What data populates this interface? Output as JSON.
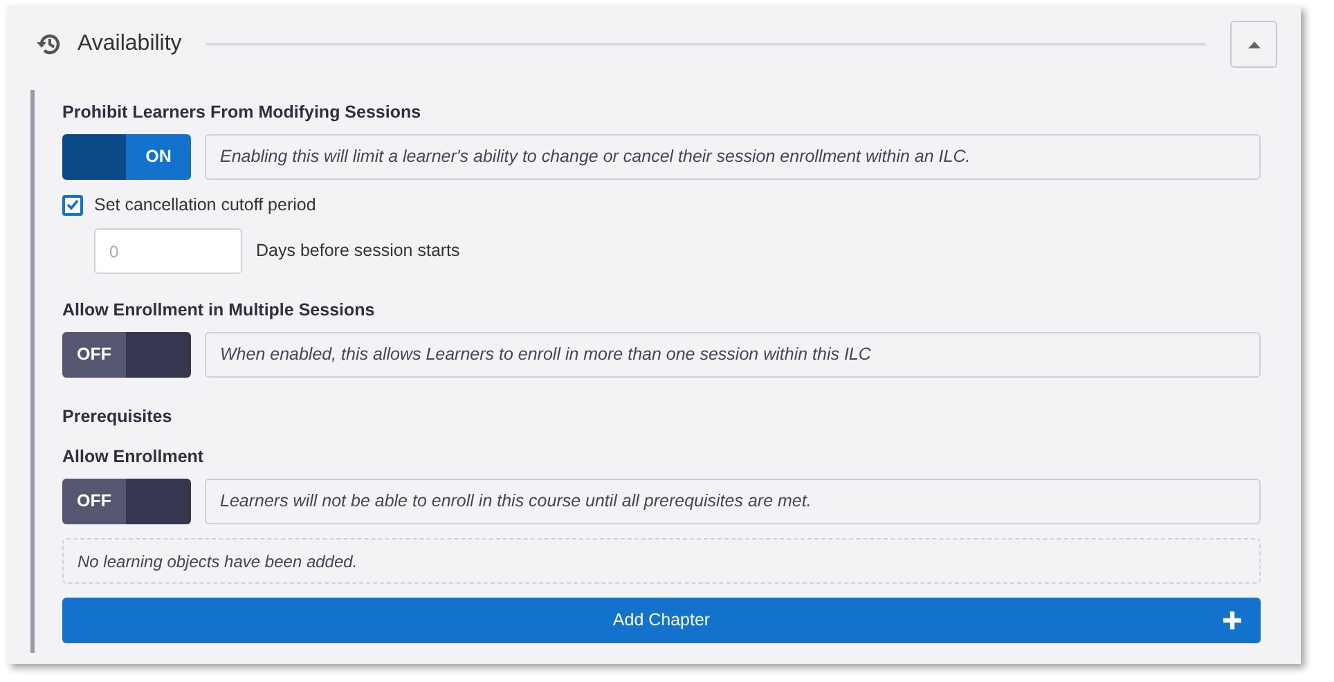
{
  "section": {
    "title": "Availability",
    "expanded": true
  },
  "settings": [
    {
      "kind": "toggle",
      "heading": "Prohibit Learners From Modifying Sessions",
      "on": true,
      "toggle_label": "ON",
      "description": "Enabling this will limit a learner's ability to change or cancel their session enrollment within an ILC."
    },
    {
      "kind": "checkbox",
      "label": "Set cancellation cutoff period",
      "checked": true,
      "field": {
        "placeholder": "0",
        "suffix": "Days before session starts"
      }
    },
    {
      "kind": "toggle",
      "heading": "Allow Enrollment in Multiple Sessions",
      "on": false,
      "toggle_label": "OFF",
      "description": "When enabled, this allows Learners to enroll in more than one session within this ILC"
    },
    {
      "kind": "subheading",
      "text": "Prerequisites"
    },
    {
      "kind": "toggle",
      "heading": "Allow Enrollment",
      "on": false,
      "toggle_label": "OFF",
      "description": "Learners will not be able to enroll in this course until all prerequisites are met."
    },
    {
      "kind": "empty",
      "text": "No learning objects have been added."
    },
    {
      "kind": "action",
      "label": "Add Chapter"
    }
  ]
}
